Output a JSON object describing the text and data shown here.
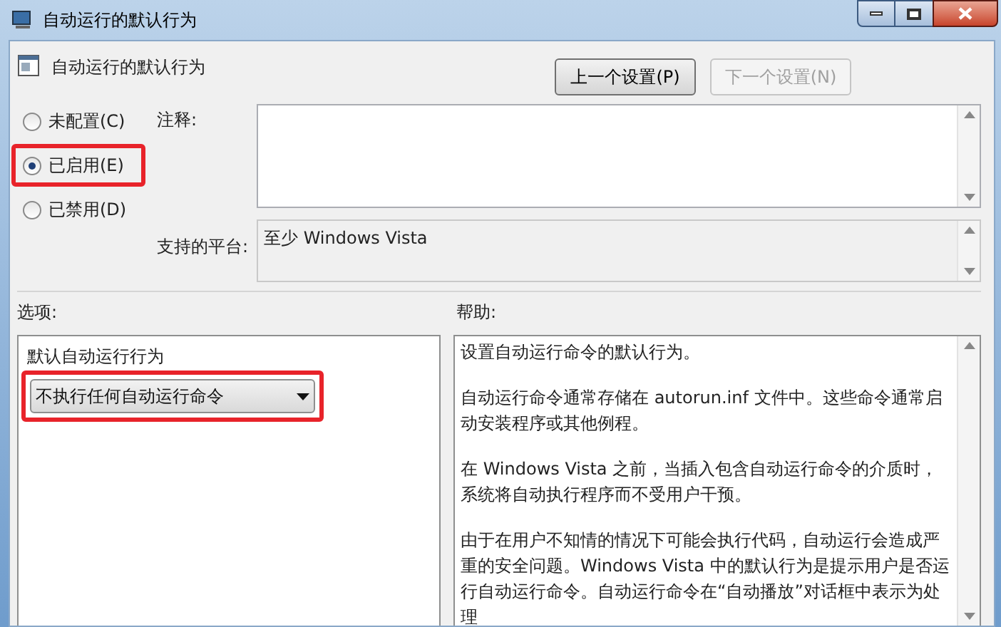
{
  "window": {
    "title": "自动运行的默认行为"
  },
  "header": {
    "title": "自动运行的默认行为"
  },
  "nav_buttons": [
    {
      "label": "上一个设置(P)",
      "disabled": false
    },
    {
      "label": "下一个设置(N)",
      "disabled": true
    }
  ],
  "state_options": [
    {
      "label": "未配置(C)",
      "selected": false,
      "highlighted": false
    },
    {
      "label": "已启用(E)",
      "selected": true,
      "highlighted": true
    },
    {
      "label": "已禁用(D)",
      "selected": false,
      "highlighted": false
    }
  ],
  "comment": {
    "label": "注释:"
  },
  "platform": {
    "label": "支持的平台:",
    "value": "至少 Windows Vista"
  },
  "options": {
    "label": "选项:",
    "field_label": "默认自动运行行为",
    "dropdown_value": "不执行任何自动运行命令",
    "highlighted": true
  },
  "help": {
    "label": "帮助:",
    "paragraphs": [
      "设置自动运行命令的默认行为。",
      "自动运行命令通常存储在 autorun.inf 文件中。这些命令通常启动安装程序或其他例程。",
      "在 Windows Vista 之前，当插入包含自动运行命令的介质时，系统将自动执行程序而不受用户干预。",
      "由于在用户不知情的情况下可能会执行代码，自动运行会造成严重的安全问题。Windows Vista 中的默认行为是提示用户是否运行自动运行命令。自动运行命令在“自动播放”对话框中表示为处理"
    ]
  }
}
